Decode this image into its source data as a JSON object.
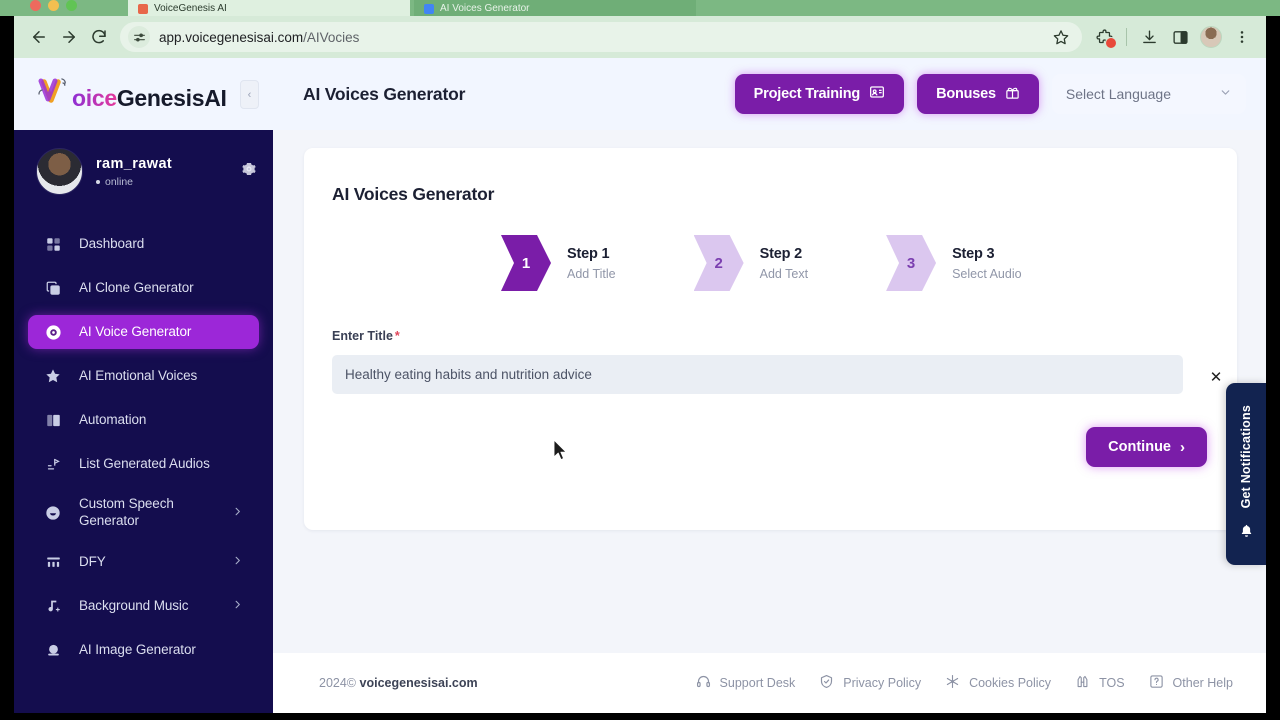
{
  "browser": {
    "url_host": "app.voicegenesisai.com",
    "url_path": "/AIVocies",
    "tabs": [
      {
        "title": "VoiceGenesis AI",
        "active": true
      },
      {
        "title": "AI Voices Generator",
        "active": false
      }
    ],
    "icons": {
      "back": "back-arrow-icon",
      "forward": "forward-arrow-icon",
      "reload": "reload-icon",
      "site_settings": "tune-sliders-icon",
      "bookmark": "star-icon",
      "extensions": "extensions-puzzle-icon",
      "downloads": "download-icon",
      "split_view": "split-panel-icon",
      "profile": "profile-avatar-icon",
      "menu": "kebab-menu-icon"
    }
  },
  "header": {
    "logo": {
      "part1": "V",
      "part2": "oice",
      "part3": "Genesis",
      "part4": "AI"
    },
    "collapse_icon": "collapse-sidebar-icon",
    "page_title": "AI Voices Generator",
    "project_training_label": "Project Training",
    "bonuses_label": "Bonuses",
    "language_label": "Select Language",
    "accent": "#7a1da8"
  },
  "sidebar": {
    "profile": {
      "name": "ram_rawat",
      "status": "online",
      "settings_icon": "gear-icon",
      "avatar": "user-avatar"
    },
    "items": [
      {
        "label": "Dashboard",
        "icon": "grid-dashboard-icon",
        "active": false,
        "caret": false
      },
      {
        "label": "AI Clone Generator",
        "icon": "clone-copy-icon",
        "active": false,
        "caret": false
      },
      {
        "label": "AI Voice Generator",
        "icon": "record-circle-icon",
        "active": true,
        "caret": false
      },
      {
        "label": "AI Emotional Voices",
        "icon": "star-icon",
        "active": false,
        "caret": false
      },
      {
        "label": "Automation",
        "icon": "book-icon",
        "active": false,
        "caret": false
      },
      {
        "label": "List Generated Audios",
        "icon": "list-audio-icon",
        "active": false,
        "caret": false
      },
      {
        "label": "Custom Speech Generator",
        "icon": "smiley-icon",
        "active": false,
        "caret": true
      },
      {
        "label": "DFY",
        "icon": "bars-icon",
        "active": false,
        "caret": true
      },
      {
        "label": "Background Music",
        "icon": "music-note-plus-icon",
        "active": false,
        "caret": true
      },
      {
        "label": "AI Image Generator",
        "icon": "image-circle-icon",
        "active": false,
        "caret": false
      }
    ],
    "active_color": "#9c27d8",
    "background": "#140d4e"
  },
  "main": {
    "card_title": "AI Voices Generator",
    "steps": [
      {
        "number": "1",
        "name": "Step 1",
        "sub": "Add Title",
        "active": true
      },
      {
        "number": "2",
        "name": "Step 2",
        "sub": "Add Text",
        "active": false
      },
      {
        "number": "3",
        "name": "Step 3",
        "sub": "Select Audio",
        "active": false
      }
    ],
    "field": {
      "label": "Enter Title",
      "required_marker": "*",
      "value": "Healthy eating habits and nutrition advice",
      "placeholder": "Enter Title"
    },
    "continue_label": "Continue",
    "continue_caret": "›"
  },
  "footer": {
    "copyright_year": "2024©",
    "copyright_site": "voicegenesisai.com",
    "links": [
      {
        "label": "Support Desk",
        "icon": "headset-icon"
      },
      {
        "label": "Privacy Policy",
        "icon": "shield-check-icon"
      },
      {
        "label": "Cookies Policy",
        "icon": "cookie-snowflake-icon"
      },
      {
        "label": "TOS",
        "icon": "document-binoculars-icon"
      },
      {
        "label": "Other Help",
        "icon": "question-box-icon"
      }
    ]
  },
  "notification": {
    "label": "Get Notifications",
    "bell_icon": "bell-icon",
    "close_icon": "close-icon",
    "background": "#122350"
  }
}
